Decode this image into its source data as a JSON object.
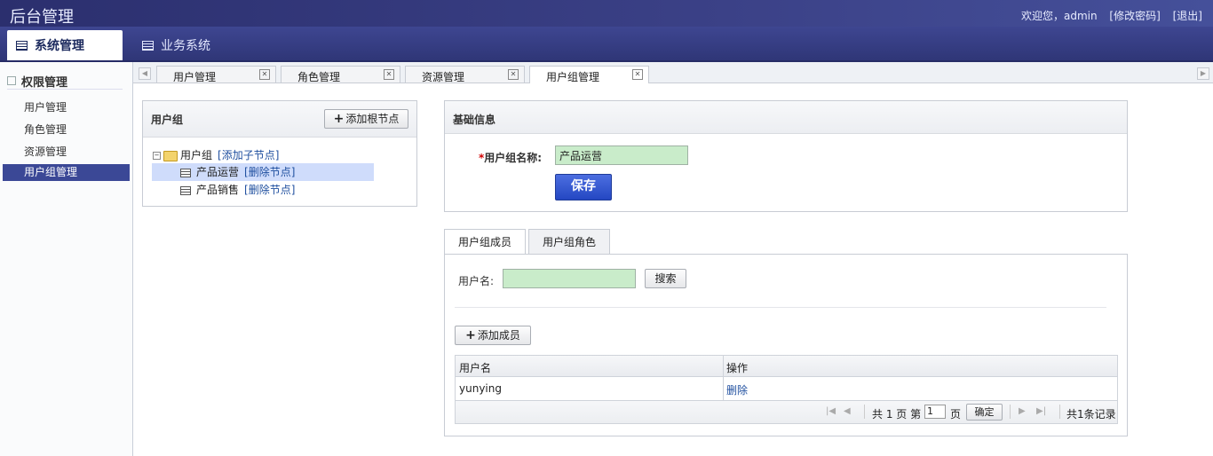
{
  "app": {
    "title": "后台管理",
    "welcome": "欢迎您，admin",
    "change_password": "[修改密码]",
    "logout": "[退出]"
  },
  "nav": {
    "tabs": [
      {
        "label": "系统管理",
        "active": true
      },
      {
        "label": "业务系统",
        "active": false
      }
    ]
  },
  "sidebar": {
    "section": "权限管理",
    "items": [
      {
        "label": "用户管理"
      },
      {
        "label": "角色管理"
      },
      {
        "label": "资源管理"
      },
      {
        "label": "用户组管理",
        "active": true
      }
    ]
  },
  "page_tabs": [
    {
      "label": "用户管理"
    },
    {
      "label": "角色管理"
    },
    {
      "label": "资源管理"
    },
    {
      "label": "用户组管理",
      "active": true
    }
  ],
  "tree_panel": {
    "title": "用户组",
    "add_root_button": "添加根节点",
    "root": {
      "label": "用户组",
      "action": "[添加子节点]"
    },
    "children": [
      {
        "label": "产品运营",
        "action": "[删除节点]",
        "selected": true
      },
      {
        "label": "产品销售",
        "action": "[删除节点]"
      }
    ]
  },
  "basic_info": {
    "title": "基础信息",
    "required_mark": "*",
    "name_label": "用户组名称:",
    "name_value": "产品运营",
    "save_button": "保存"
  },
  "members": {
    "tabs": [
      {
        "label": "用户组成员",
        "active": true
      },
      {
        "label": "用户组角色"
      }
    ],
    "search_label": "用户名:",
    "search_value": "",
    "search_button": "搜索",
    "add_member_button": "添加成员",
    "columns": [
      "用户名",
      "操作"
    ],
    "rows": [
      {
        "username": "yunying",
        "action": "删除"
      }
    ],
    "pager": {
      "prefix": "共 1 页 第",
      "current_page": "1",
      "suffix": "页",
      "confirm_button": "确定",
      "total": "共1条记录"
    }
  },
  "colors": {
    "header": "#2b2f6e",
    "sidebar_active": "#3b4896",
    "input_bg": "#c9ecca",
    "save_button": "#2447c2",
    "link": "#1f4f9f"
  }
}
